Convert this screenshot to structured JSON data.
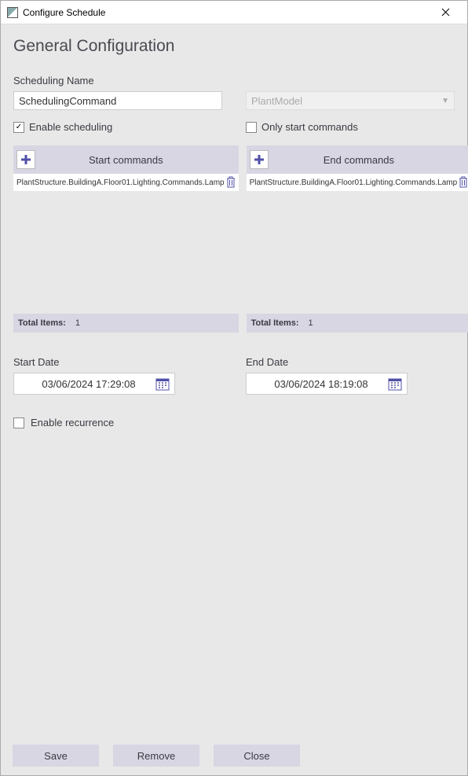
{
  "window": {
    "title": "Configure Schedule"
  },
  "heading": "General Configuration",
  "fields": {
    "scheduling_name_label": "Scheduling Name",
    "scheduling_name_value": "SchedulingCommand",
    "model_dropdown": "PlantModel",
    "enable_scheduling_label": "Enable scheduling",
    "only_start_label": "Only start commands",
    "start_date_label": "Start Date",
    "start_date_value": "03/06/2024 17:29:08",
    "end_date_label": "End Date",
    "end_date_value": "03/06/2024 18:19:08",
    "enable_recurrence_label": "Enable recurrence"
  },
  "start_commands": {
    "title": "Start commands",
    "item": "PlantStructure.BuildingA.Floor01.Lighting.Commands.Lamp",
    "total_label": "Total Items:",
    "total_count": "1"
  },
  "end_commands": {
    "title": "End commands",
    "item": "PlantStructure.BuildingA.Floor01.Lighting.Commands.Lamp",
    "total_label": "Total Items:",
    "total_count": "1"
  },
  "buttons": {
    "save": "Save",
    "remove": "Remove",
    "close": "Close"
  }
}
